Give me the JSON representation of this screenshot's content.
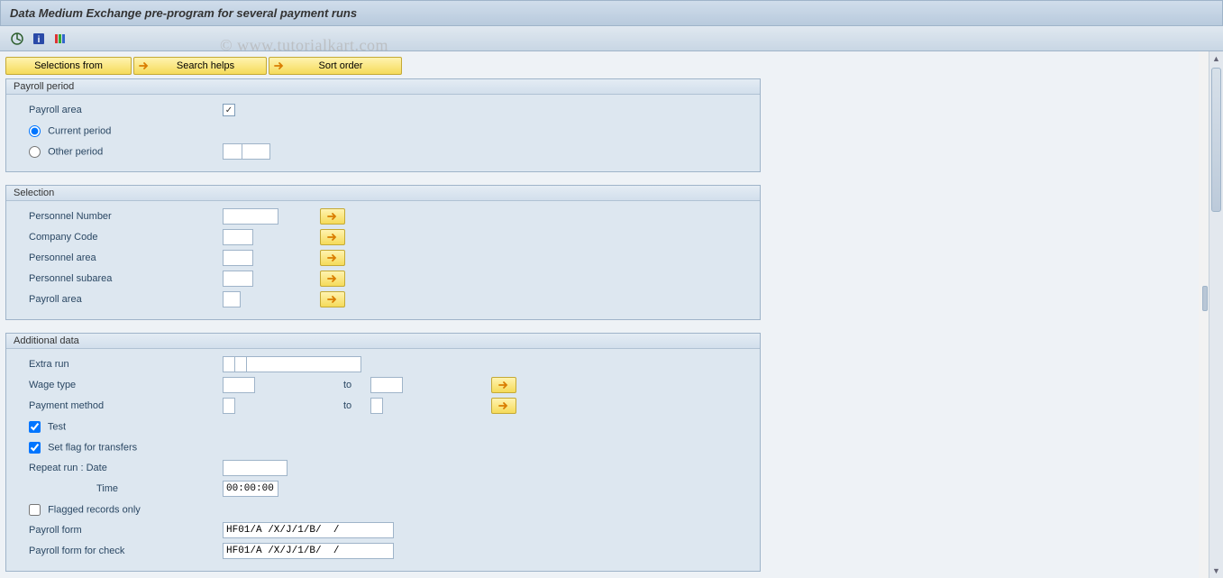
{
  "title": "Data Medium Exchange pre-program for several payment runs",
  "watermark": "© www.tutorialkart.com",
  "toolbar_buttons": {
    "selections_from": "Selections from",
    "search_helps": "Search helps",
    "sort_order": "Sort order"
  },
  "panels": {
    "payroll_period": {
      "title": "Payroll period",
      "payroll_area_label": "Payroll area",
      "current_period_label": "Current period",
      "other_period_label": "Other period"
    },
    "selection": {
      "title": "Selection",
      "personnel_number": "Personnel Number",
      "company_code": "Company Code",
      "personnel_area": "Personnel area",
      "personnel_subarea": "Personnel subarea",
      "payroll_area": "Payroll area"
    },
    "additional": {
      "title": "Additional data",
      "extra_run": "Extra run",
      "wage_type": "Wage type",
      "to": "to",
      "payment_method": "Payment method",
      "test": "Test",
      "set_flag": "Set flag for transfers",
      "repeat_run": "Repeat run    : Date",
      "time_label": "Time",
      "time_value": "00:00:00",
      "flagged_only": "Flagged records only",
      "payroll_form": "Payroll form",
      "payroll_form_value": "HF01/A /X/J/1/B/  /",
      "payroll_form_check": "Payroll form for check",
      "payroll_form_check_value": "HF01/A /X/J/1/B/  /"
    }
  }
}
